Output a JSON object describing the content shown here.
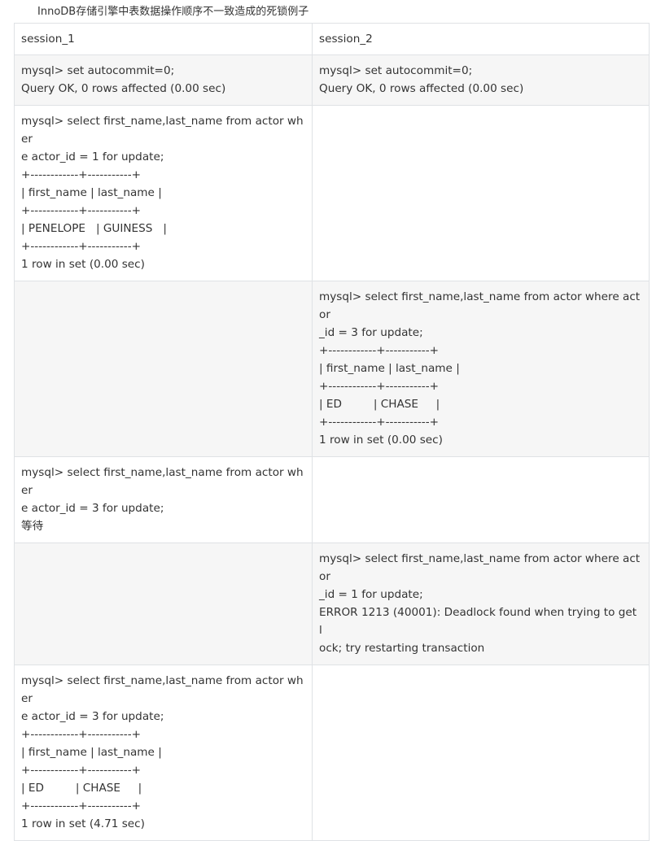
{
  "caption": "InnoDB存储引擎中表数据操作顺序不一致造成的死锁例子",
  "columns": [
    "session_1",
    "session_2"
  ],
  "rows": [
    {
      "session_1": [
        "mysql> set autocommit=0;",
        "Query OK, 0 rows affected (0.00 sec)"
      ],
      "session_2": [
        "mysql> set autocommit=0;",
        "Query OK, 0 rows affected (0.00 sec)"
      ]
    },
    {
      "session_1": [
        "mysql> select first_name,last_name from actor wher",
        "e actor_id = 1 for update;",
        "+------------+-----------+",
        "| first_name | last_name |",
        "+------------+-----------+",
        "| PENELOPE   | GUINESS   |",
        "+------------+-----------+",
        "1 row in set (0.00 sec)"
      ],
      "session_2": []
    },
    {
      "session_1": [],
      "session_2": [
        "mysql> select first_name,last_name from actor where actor",
        "_id = 3 for update;",
        "+------------+-----------+",
        "| first_name | last_name |",
        "+------------+-----------+",
        "| ED         | CHASE     |",
        "+------------+-----------+",
        "1 row in set (0.00 sec)"
      ]
    },
    {
      "session_1": [
        "mysql> select first_name,last_name from actor wher",
        "e actor_id = 3 for update;",
        "等待"
      ],
      "session_2": []
    },
    {
      "session_1": [],
      "session_2": [
        "mysql> select first_name,last_name from actor where actor",
        "_id = 1 for update;",
        "ERROR 1213 (40001): Deadlock found when trying to get l",
        "ock; try restarting transaction"
      ]
    },
    {
      "session_1": [
        "mysql> select first_name,last_name from actor wher",
        "e actor_id = 3 for update;",
        "+------------+-----------+",
        "| first_name | last_name |",
        "+------------+-----------+",
        "| ED         | CHASE     |",
        "+------------+-----------+",
        "1 row in set (4.71 sec)"
      ],
      "session_2": []
    }
  ]
}
